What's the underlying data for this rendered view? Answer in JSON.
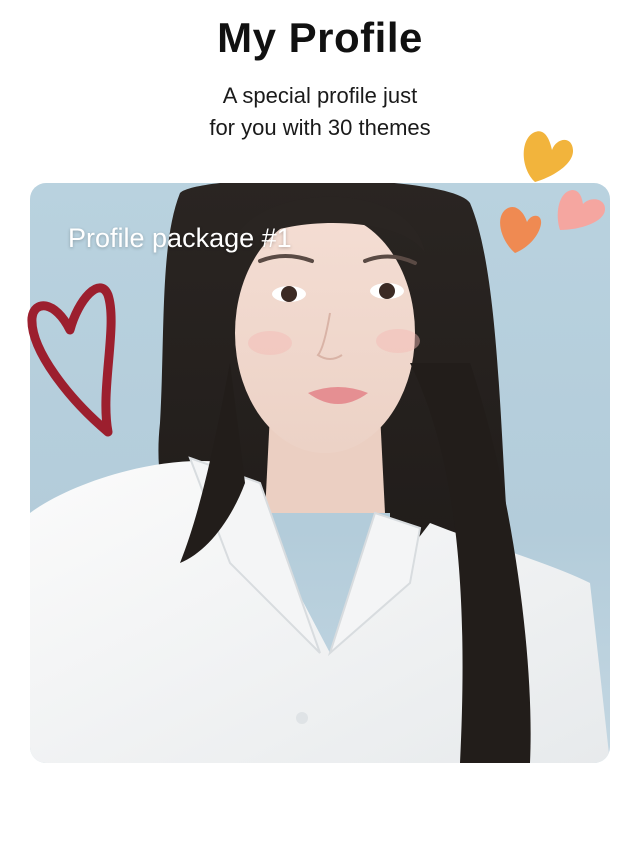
{
  "header": {
    "title": "My Profile",
    "subtitle_line1": "A special profile just",
    "subtitle_line2": "for you with 30 themes"
  },
  "card": {
    "label": "Profile package #1",
    "image_subject": "portrait-photo"
  },
  "decorations": [
    {
      "icon": "heart-outline-icon",
      "color": "#9c1f2e"
    },
    {
      "icon": "heart-icon",
      "color": "#f2b43c"
    },
    {
      "icon": "heart-icon",
      "color": "#ef8a52"
    },
    {
      "icon": "heart-icon",
      "color": "#f5a6a0"
    }
  ],
  "colors": {
    "background": "#ffffff",
    "card_background": "#b9d2df",
    "title_text": "#111111"
  }
}
